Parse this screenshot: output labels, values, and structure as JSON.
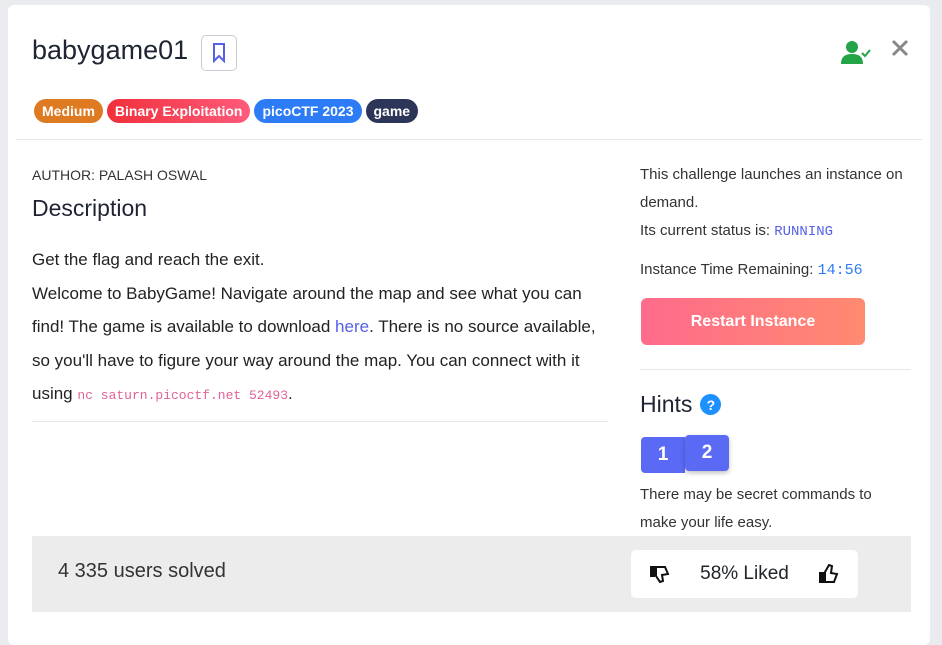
{
  "title": "babygame01",
  "tags": [
    {
      "label": "Medium",
      "color": "#dd7a22"
    },
    {
      "label": "Binary Exploitation",
      "color": "#f0405a"
    },
    {
      "label": "picoCTF 2023",
      "color": "#2d7cf6"
    },
    {
      "label": "game",
      "color": "#2d3658"
    }
  ],
  "author": "AUTHOR: PALASH OSWAL",
  "description_heading": "Description",
  "description": {
    "line1": "Get the flag and reach the exit.",
    "p1": "Welcome to BabyGame! Navigate around the map and see what you can find! The game is available to download ",
    "link": "here",
    "p2": ". There is no source available, so you'll have to figure your way around the map. You can connect with it using ",
    "command": "nc saturn.picoctf.net 52493",
    "p3": "."
  },
  "instance": {
    "info": "This challenge launches an instance on demand.",
    "status_label": "Its current status is: ",
    "status": "RUNNING",
    "time_label": "Instance Time Remaining: ",
    "time": "14:56",
    "restart": "Restart Instance"
  },
  "hints": {
    "heading": "Hints",
    "buttons": [
      "1",
      "2"
    ],
    "text": "There may be secret commands to make your life easy."
  },
  "footer": {
    "solved": "4 335 users solved",
    "liked": "58% Liked"
  }
}
